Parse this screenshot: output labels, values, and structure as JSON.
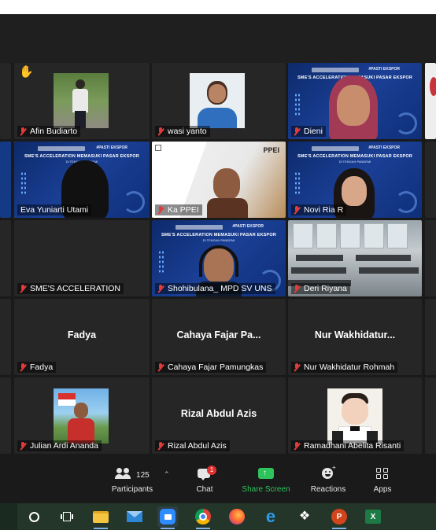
{
  "participants": [
    {
      "name": "Afin Budiarto",
      "muted": true,
      "raised_hand": true
    },
    {
      "name": "wasi yanto",
      "muted": true
    },
    {
      "name": "Dieni",
      "muted": true
    },
    {
      "name": "Eva Yuniarti Utami",
      "muted": false,
      "active_speaker": true
    },
    {
      "name": "Ka PPEI",
      "muted": true
    },
    {
      "name": "Novi Ria R",
      "muted": true
    },
    {
      "name": "SME'S ACCELERATION",
      "muted": true
    },
    {
      "name": "Shohibulana_ MPD SV UNS",
      "muted": true
    },
    {
      "name": "Deri Riyana",
      "muted": true
    },
    {
      "name": "Fadya",
      "display": "Fadya",
      "muted": true
    },
    {
      "name": "Cahaya Fajar Pamungkas",
      "display": "Cahaya Fajar Pa...",
      "muted": true
    },
    {
      "name": "Nur Wakhidatur Rohmah",
      "display": "Nur Wakhidatur...",
      "muted": true
    },
    {
      "name": "Julian Ardi Ananda",
      "muted": true
    },
    {
      "name": "Rizal Abdul Azis",
      "display": "Rizal Abdul Azis",
      "muted": true
    },
    {
      "name": "Ramadhani Abelita Risanti",
      "muted": true
    }
  ],
  "banner": {
    "title": "SME'S ACCELERATION MEMASUKI PASAR EKSPOR",
    "subtitle": "DI TENGAH PANDEMI",
    "logo_text": "#PASTI EKSPOR"
  },
  "ppei_label": "PPEI",
  "toolbar": {
    "participants_label": "Participants",
    "participants_count": "125",
    "chat_label": "Chat",
    "chat_badge": "1",
    "share_label": "Share Screen",
    "reactions_label": "Reactions",
    "apps_label": "Apps"
  },
  "colors": {
    "share_green": "#2fc35c",
    "active_outline": "#d6e76a",
    "muted_red": "#e23b3b",
    "badge_red": "#e0312f",
    "taskbar": "#243529"
  },
  "taskbar_icons": [
    "search-circle-icon",
    "task-view-icon",
    "file-explorer-icon",
    "mail-icon",
    "zoom-icon",
    "chrome-icon",
    "firefox-icon",
    "edge-icon",
    "dropbox-icon",
    "powerpoint-icon",
    "excel-icon"
  ]
}
